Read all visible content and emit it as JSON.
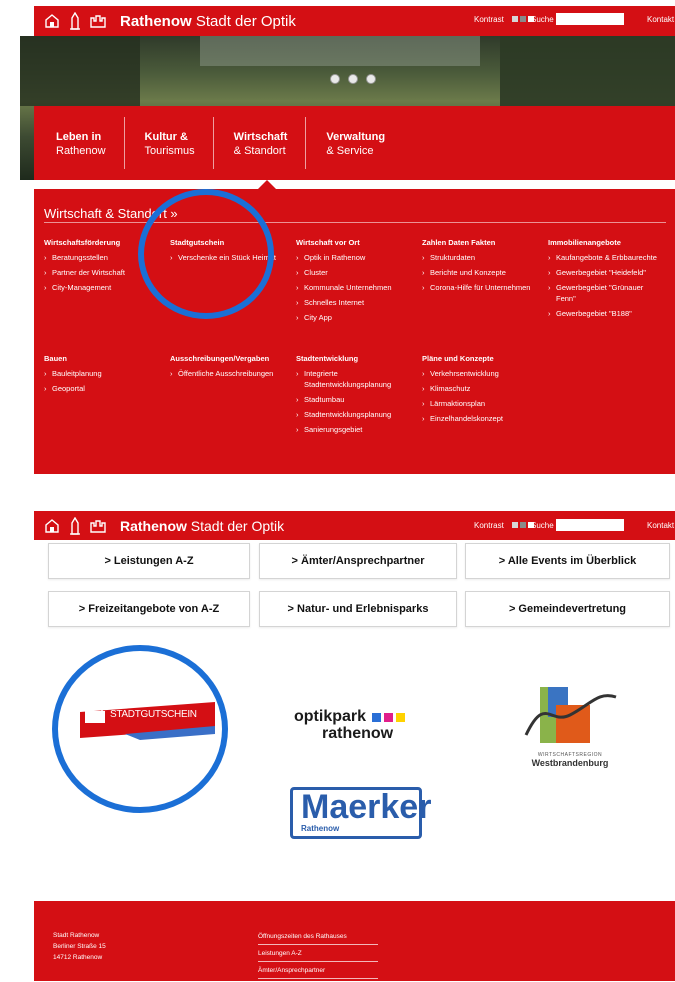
{
  "header": {
    "brand_bold": "Rathenow",
    "brand_rest": "Stadt der Optik",
    "kontrast": "Kontrast",
    "suche": "Suche",
    "kontakt": "Kontakt"
  },
  "nav": [
    {
      "line1": "Leben in",
      "line2": "Rathenow"
    },
    {
      "line1": "Kultur &",
      "line2": "Tourismus"
    },
    {
      "line1": "Wirtschaft",
      "line2": "& Standort"
    },
    {
      "line1": "Verwaltung",
      "line2": "& Service"
    }
  ],
  "mega": {
    "title": "Wirtschaft & Standort »",
    "columns": [
      {
        "heading": "Wirtschaftsförderung",
        "items": [
          "Beratungsstellen",
          "Partner der Wirtschaft",
          "City-Management"
        ]
      },
      {
        "heading": "Stadtgutschein",
        "items": [
          "Verschenke ein Stück Heimat"
        ]
      },
      {
        "heading": "Wirtschaft vor Ort",
        "items": [
          "Optik in Rathenow",
          "Cluster",
          "Kommunale Unternehmen",
          "Schnelles Internet",
          "City App"
        ]
      },
      {
        "heading": "Zahlen Daten Fakten",
        "items": [
          "Strukturdaten",
          "Berichte und Konzepte",
          "Corona-Hilfe für Unternehmen"
        ]
      },
      {
        "heading": "Immobilienangebote",
        "items": [
          "Kaufangebote & Erbbaurechte",
          "Gewerbegebiet \"Heidefeld\"",
          "Gewerbegebiet \"Grünauer Fenn\"",
          "Gewerbegebiet \"B188\""
        ]
      },
      {
        "heading": "Bauen",
        "items": [
          "Bauleitplanung",
          "Geoportal"
        ]
      },
      {
        "heading": "Ausschreibungen/Vergaben",
        "items": [
          "Öffentliche Ausschreibungen"
        ]
      },
      {
        "heading": "Stadtentwicklung",
        "items": [
          "Integrierte Stadtentwicklungsplanung",
          "Stadtumbau",
          "Stadtentwicklungsplanung",
          "Sanierungsgebiet"
        ]
      },
      {
        "heading": "Pläne und Konzepte",
        "items": [
          "Verkehrsentwicklung",
          "Klimaschutz",
          "Lärmaktionsplan",
          "Einzelhandelskonzept"
        ]
      }
    ]
  },
  "quicklinks": [
    "> Leistungen A-Z",
    "> Ämter/Ansprechpartner",
    "> Alle Events im Überblick",
    "> Freizeitangebote von A-Z",
    "> Natur- und Erlebnisparks",
    "> Gemeindevertretung"
  ],
  "logos": {
    "stadtgutschein": "STADTGUTSCHEIN",
    "optikpark_1": "optikpark",
    "optikpark_2": "rathenow",
    "maerker": "Maerker",
    "maerker_sub": "Rathenow",
    "region_1": "WIRTSCHAFTSREGION",
    "region_2": "Westbrandenburg"
  },
  "footer": {
    "address": [
      "Stadt Rathenow",
      "Berliner Straße 15",
      "14712 Rathenow"
    ],
    "links": [
      "Öffnungszeiten des Rathauses",
      "Leistungen A-Z",
      "Ämter/Ansprechpartner"
    ]
  },
  "colors": {
    "brand_red": "#d40f14",
    "highlight_blue": "#1b6fd6",
    "maerker_blue": "#2a5dab"
  }
}
